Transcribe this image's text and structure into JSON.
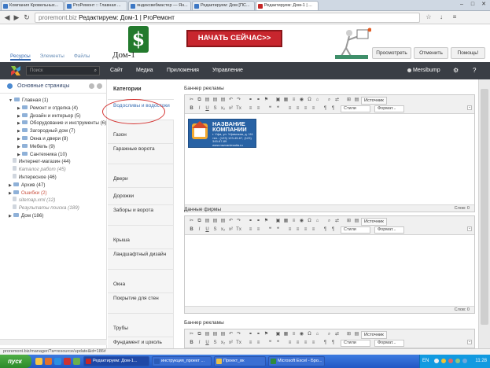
{
  "browser": {
    "tabs": [
      {
        "label": "Компания Кровельных..."
      },
      {
        "label": "ProРемонт :: Главная ..."
      },
      {
        "label": "яндексвебмастер — Ян..."
      },
      {
        "label": "Редактируем: Дом [ПС..."
      },
      {
        "label": "Редактируем: Дом-1 | ..."
      }
    ],
    "url_host": "proremont.biz",
    "url_title": "Редактируем: Дом-1 | ProРемонт"
  },
  "ad": {
    "button_text": "НАЧАТЬ СЕЙЧАС>>",
    "logo_partial": "Дом-1"
  },
  "page_actions": {
    "view": "Просмотреть",
    "apply": "Отменить",
    "help": "Помощь!"
  },
  "page_tabs": [
    "Ресурсы",
    "Элементы",
    "Файлы"
  ],
  "nav": {
    "search_placeholder": "Поиск",
    "items": [
      "Сайт",
      "Медиа",
      "Приложения",
      "Управление"
    ],
    "user": "Mersibump"
  },
  "tree": {
    "header": "Основные страницы",
    "nodes": [
      {
        "label": "Главная (1)",
        "level": 0,
        "arrow": "▼",
        "style": "normal"
      },
      {
        "label": "Ремонт и отделка (4)",
        "level": 1,
        "arrow": "▶",
        "style": "normal"
      },
      {
        "label": "Дизайн и интерьер (5)",
        "level": 1,
        "arrow": "▶",
        "style": "normal"
      },
      {
        "label": "Оборудование и инструменты (6)",
        "level": 1,
        "arrow": "▶",
        "style": "normal"
      },
      {
        "label": "Загородный дом (7)",
        "level": 1,
        "arrow": "▶",
        "style": "normal"
      },
      {
        "label": "Окна и двери (8)",
        "level": 1,
        "arrow": "▶",
        "style": "normal"
      },
      {
        "label": "Мебель (9)",
        "level": 1,
        "arrow": "▶",
        "style": "normal"
      },
      {
        "label": "Сантехника (10)",
        "level": 1,
        "arrow": "▶",
        "style": "normal"
      },
      {
        "label": "Интернет-магазин (44)",
        "level": 0,
        "arrow": "",
        "style": "normal"
      },
      {
        "label": "Каталог работ (45)",
        "level": 0,
        "arrow": "",
        "style": "muted"
      },
      {
        "label": "Интересное (46)",
        "level": 0,
        "arrow": "",
        "style": "normal"
      },
      {
        "label": "Архив (47)",
        "level": 0,
        "arrow": "▶",
        "style": "normal"
      },
      {
        "label": "Ошибки (2)",
        "level": 0,
        "arrow": "▶",
        "style": "red"
      },
      {
        "label": "sitemap.xml (12)",
        "level": 0,
        "arrow": "",
        "style": "muted"
      },
      {
        "label": "Результаты поиска (189)",
        "level": 0,
        "arrow": "",
        "style": "muted"
      },
      {
        "label": "Дом (186)",
        "level": 0,
        "arrow": "▶",
        "style": "normal"
      }
    ]
  },
  "categories": {
    "header": "Категории",
    "items": [
      "Водосливы и водостоки",
      "Газон",
      "Гаражные ворота",
      "Двери",
      "Дорожки",
      "Заборы и ворота",
      "Крыша",
      "Ландшафтный дизайн",
      "Окна",
      "Покрытие для стен",
      "Трубы",
      "Фундамент и цоколь"
    ]
  },
  "editors": [
    {
      "label": "Баннер рекламы",
      "status": "Слов: 0",
      "has_image": true
    },
    {
      "label": "Данные фирмы",
      "status": "Слов: 0",
      "has_image": false
    },
    {
      "label": "Баннер рекламы",
      "status": "",
      "has_image": false
    }
  ],
  "toolbar": {
    "source": "Источник",
    "styles": "Стили",
    "format": "Формат..."
  },
  "company_banner": {
    "title": "НАЗВАНИЕ КОМПАНИИ",
    "line1": "г. Уфа, ул. Уфимская, д. 111",
    "line2": "тел.: (123) 123-45-67, (123) 345-67-89",
    "line3": "www.nazvaniesaita.ru"
  },
  "status_url": "proremont.biz/manager/?a=resource/update&id=186#",
  "taskbar": {
    "start": "пуск",
    "tasks": [
      {
        "label": "Редактируем: Дом-1..."
      },
      {
        "label": "инструкция_проект ..."
      },
      {
        "label": "Проект_вк"
      },
      {
        "label": "Microsoft Excel - Бро..."
      }
    ],
    "lang": "EN",
    "clock": "11:28"
  },
  "colors": {
    "nav_dark": "#3a3e45",
    "accent_blue": "#3a6fb3",
    "annotation_red": "#d53533",
    "ad_red": "#c8262e"
  }
}
